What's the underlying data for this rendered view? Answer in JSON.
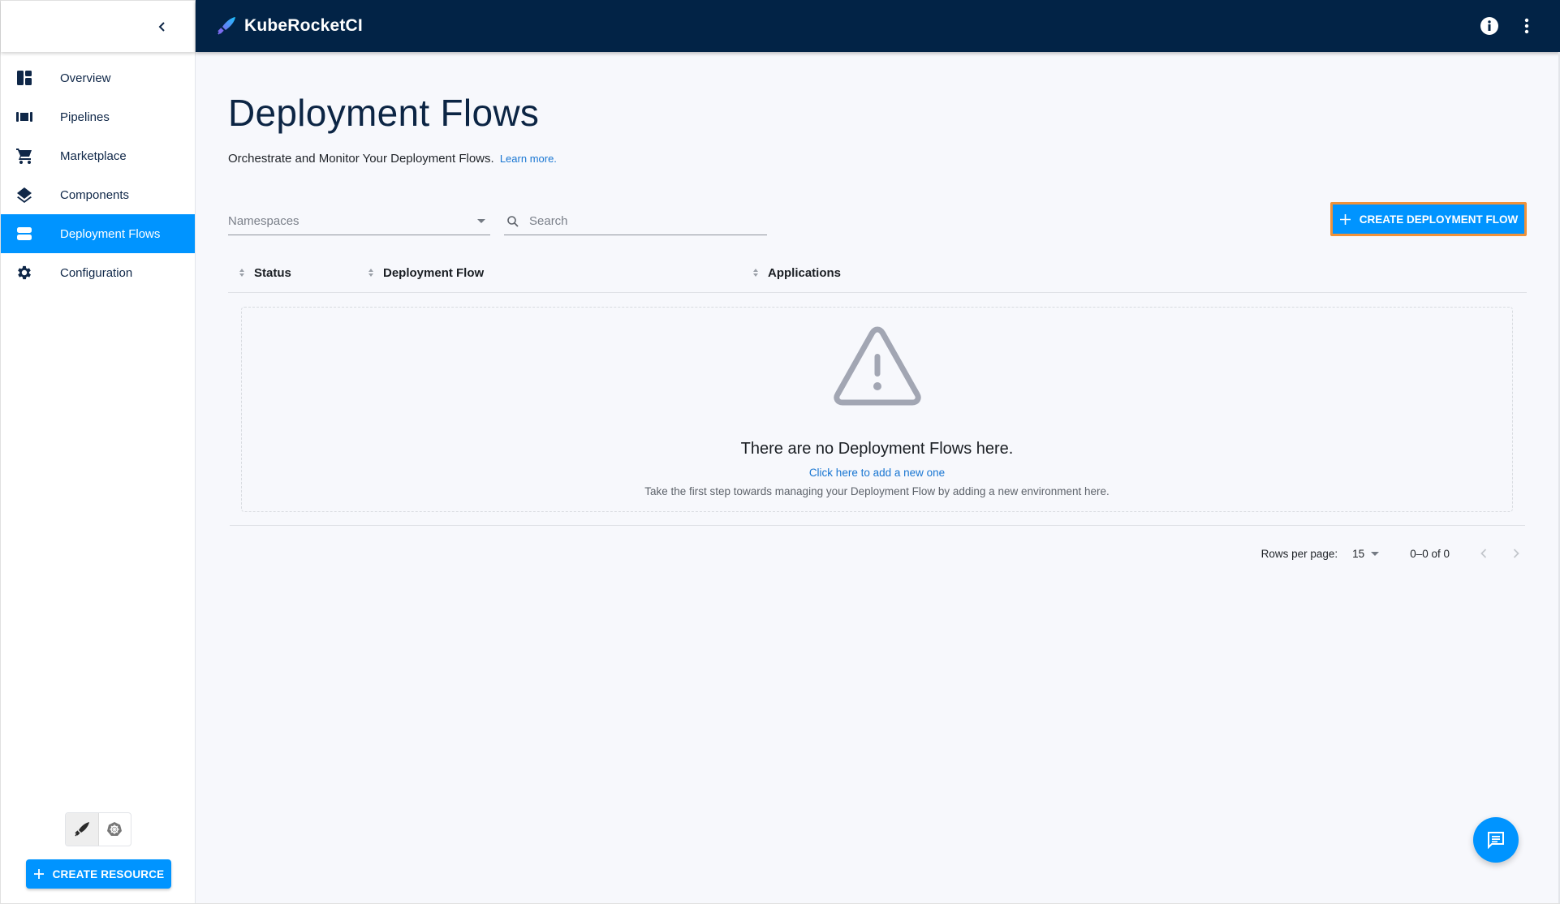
{
  "app": {
    "brand": "KubeRocketCI",
    "colors": {
      "header_bg": "#022346",
      "accent": "#0094ff",
      "highlight_outline": "#f0923a",
      "link": "#1976d2"
    }
  },
  "header": {
    "logo_icon": "rocket-icon",
    "actions": [
      {
        "name": "info",
        "icon": "info-icon"
      },
      {
        "name": "more",
        "icon": "more-vertical-icon"
      }
    ]
  },
  "sidebar": {
    "collapse_icon": "chevron-left-icon",
    "items": [
      {
        "label": "Overview",
        "icon": "dashboard-icon",
        "active": false
      },
      {
        "label": "Pipelines",
        "icon": "pipelines-icon",
        "active": false
      },
      {
        "label": "Marketplace",
        "icon": "cart-icon",
        "active": false
      },
      {
        "label": "Components",
        "icon": "layers-icon",
        "active": false
      },
      {
        "label": "Deployment Flows",
        "icon": "flows-icon",
        "active": true
      },
      {
        "label": "Configuration",
        "icon": "gear-icon",
        "active": false
      }
    ],
    "mode_toggle": [
      {
        "name": "krci",
        "icon": "rocket-icon",
        "selected": true
      },
      {
        "name": "kubernetes",
        "icon": "kubernetes-icon",
        "selected": false
      }
    ],
    "create_resource_label": "CREATE RESOURCE"
  },
  "page": {
    "title": "Deployment Flows",
    "description": "Orchestrate and Monitor Your Deployment Flows.",
    "learn_more": "Learn more.",
    "filters": {
      "namespaces_placeholder": "Namespaces",
      "search_placeholder": "Search",
      "search_value": ""
    },
    "create_button_label": "CREATE DEPLOYMENT FLOW",
    "table": {
      "columns": [
        "Status",
        "Deployment Flow",
        "Applications"
      ],
      "rows": [],
      "empty": {
        "icon": "warning-icon",
        "title": "There are no Deployment Flows here.",
        "link": "Click here to add a new one",
        "subtitle": "Take the first step towards managing your Deployment Flow by adding a new environment here."
      }
    },
    "pagination": {
      "rows_per_page_label": "Rows per page:",
      "rows_per_page": "15",
      "range": "0–0 of 0"
    }
  },
  "fab": {
    "icon": "chat-icon"
  }
}
